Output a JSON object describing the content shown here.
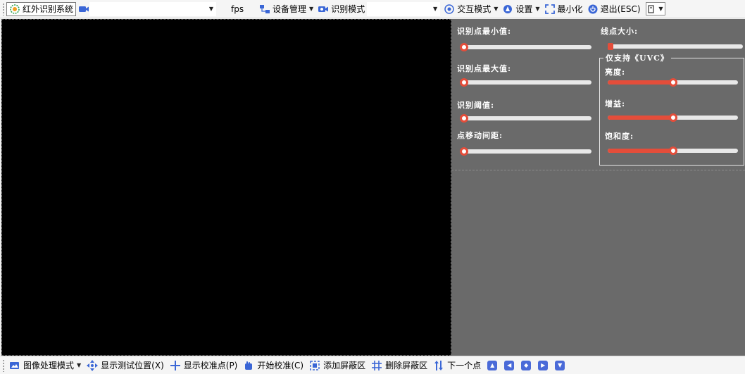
{
  "toolbar": {
    "app_title": "红外识别系统",
    "fps_label": "fps",
    "device_mgmt": "设备管理",
    "recog_mode": "识别模式",
    "interact_mode": "交互模式",
    "settings": "设置",
    "minimize": "最小化",
    "exit": "退出(ESC)"
  },
  "panel": {
    "min_point_label": "识别点最小值:",
    "max_point_label": "识别点最大值:",
    "threshold_label": "识别阈值:",
    "move_dist_label": "点移动间距:",
    "line_size_label": "线点大小:",
    "uvc_group_title": "仅支持《UVC》",
    "brightness_label": "亮度:",
    "gain_label": "增益:",
    "saturation_label": "饱和度:"
  },
  "sliders": {
    "min_point": 0,
    "max_point": 0,
    "threshold": 0,
    "move_dist": 0,
    "line_size": 0,
    "brightness": 0.5,
    "gain": 0.5,
    "saturation": 0.5
  },
  "bottombar": {
    "image_mode": "图像处理模式",
    "show_test_pos": "显示测试位置(X)",
    "show_calib_pts": "显示校准点(P)",
    "start_calib": "开始校准(C)",
    "add_mask": "添加屏蔽区",
    "delete_mask": "删除屏蔽区",
    "next_point": "下一个点"
  },
  "colors": {
    "accent": "#e44d3a",
    "panel_bg": "#6a6a6a",
    "icon_blue": "#3a66d6"
  },
  "icons": [
    "logo-icon",
    "camera-icon",
    "device-icon",
    "recog-camera-icon",
    "target-icon",
    "gear-icon",
    "fullscreen-icon",
    "power-icon",
    "window-icon",
    "image-icon",
    "move-icon",
    "crosshair-icon",
    "hand-icon",
    "mask-add-icon",
    "grid-icon",
    "updown-arrow-icon",
    "up-icon",
    "left-icon",
    "center-icon",
    "right-icon",
    "down-icon"
  ]
}
